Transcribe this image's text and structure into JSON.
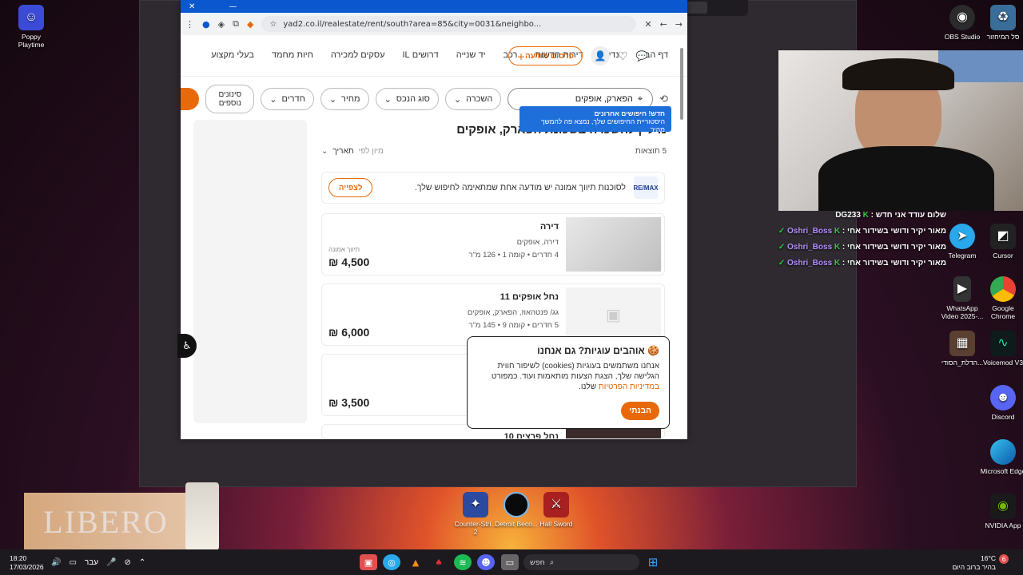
{
  "desktop": {
    "icons_left": [
      {
        "label": "Poppy Playtime",
        "icon": "poppy-game-icon"
      }
    ],
    "icons_top_right": [
      {
        "label": "OBS Studio",
        "icon": "obs-icon"
      },
      {
        "label": "סל המיחזור",
        "icon": "recycle-bin-icon"
      }
    ],
    "icons_right": [
      {
        "label": "Telegram",
        "icon": "telegram-icon",
        "color": "#29a9eb"
      },
      {
        "label": "Cursor",
        "icon": "cursor-app-icon",
        "color": "#222222"
      },
      {
        "label": "WhatsApp Video 2025-...",
        "icon": "video-file-icon",
        "color": "#333333"
      },
      {
        "label": "Google Chrome",
        "icon": "chrome-icon",
        "color": "#4285f4"
      },
      {
        "label": "הדלת_הסודי...",
        "icon": "image-file-icon",
        "color": "#5a4030"
      },
      {
        "label": "Voicemod V3",
        "icon": "voicemod-icon",
        "color": "#0d1b1b"
      },
      {
        "label": "Discord",
        "icon": "discord-icon",
        "color": "#5865f2"
      },
      {
        "label": "Microsoft Edge",
        "icon": "edge-icon",
        "color": "#0c7bd6"
      },
      {
        "label": "NVIDIA App",
        "icon": "nvidia-icon",
        "color": "#76b900"
      }
    ],
    "icons_bottom": [
      {
        "label": "Counter-Stri... 2",
        "icon": "cs2-icon"
      },
      {
        "label": "Detroit Beco...",
        "icon": "detroit-icon"
      },
      {
        "label": "Hall Sword",
        "icon": "hall-sword-icon"
      }
    ]
  },
  "browser": {
    "url": "yad2.co.il/realestate/rent/south?area=85&city=0031&neighbo...",
    "nav_items": [
      "דף הבית",
      "נדל\"ן",
      "דירות חדשות",
      "רכב",
      "יד שנייה",
      "דרושים IL",
      "עסקים למכירה",
      "חיות מחמד",
      "בעלי מקצוע"
    ],
    "post_button": "פרסום מודעה",
    "search_value": "הפארק, אופקים",
    "filters": [
      "השכרה",
      "סוג הנכס",
      "מחיר",
      "חדרים",
      "סינונים נוספים"
    ],
    "tooltip": {
      "title": "חדש! חיפושים אחרונים",
      "text": "היסטוריית החיפושים שלך, נמצא פה להמשך מהיר"
    },
    "page_title": "נדל\"ן להשכרה בשכונת הפארק, אופקים",
    "results_count": "5 תוצאות",
    "sort_label": "מיון לפי",
    "sort_value": "תאריך",
    "agency_banner": {
      "text": "לסוכנות תיווך אמונה יש מודעה אחת שמתאימה לחיפוש שלך.",
      "button": "לצפייה"
    },
    "listings": [
      {
        "title": "דירה",
        "subtitle": "דירה, אופקים",
        "details": "4 חדרים • קומה 1 • 126 מ\"ר",
        "agency": "תיווך אמונה",
        "price": "4,500 ₪"
      },
      {
        "title": "נחל אופקים 11",
        "subtitle": "גג/ פנטהאוז, הפארק, אופקים",
        "details": "5 חדרים • קומה 9 • 145 מ\"ר",
        "agency": "",
        "price": "6,000 ₪"
      },
      {
        "title": "",
        "subtitle": "",
        "details": "",
        "agency": "",
        "price": "3,500 ₪"
      },
      {
        "title": "נחל פרצים 10",
        "subtitle": "",
        "details": "",
        "agency": "",
        "price": ""
      }
    ],
    "cookie": {
      "title": "אוהבים עוגיות? גם אנחנו",
      "text": "אנחנו משתמשים בעוגיות (cookies) לשיפור חווית הגלישה שלך, הצגת הצעות מותאמות ועוד. כמפורט",
      "link": "במדיניות הפרטיות",
      "text_end": "שלנו.",
      "button": "הבנתי"
    }
  },
  "chat": [
    {
      "user": "DG233",
      "message": "שלום עודד אני חדש"
    },
    {
      "user": "Oshri_Boss",
      "message": "מאור יקיר ודושי בשידור אחי"
    },
    {
      "user": "Oshri_Boss",
      "message": "מאור יקיר ודושי בשידור אחי"
    },
    {
      "user": "Oshri_Boss",
      "message": "מאור יקיר ודושי בשידור אחי"
    }
  ],
  "overlay": {
    "brand": "LIBERO"
  },
  "taskbar": {
    "time": "18:20",
    "date": "17/03/2026",
    "lang": "עבר",
    "search_label": "חפש",
    "weather_temp": "16°C",
    "weather_text": "בהיר ברוב היום",
    "notifications": "6"
  }
}
